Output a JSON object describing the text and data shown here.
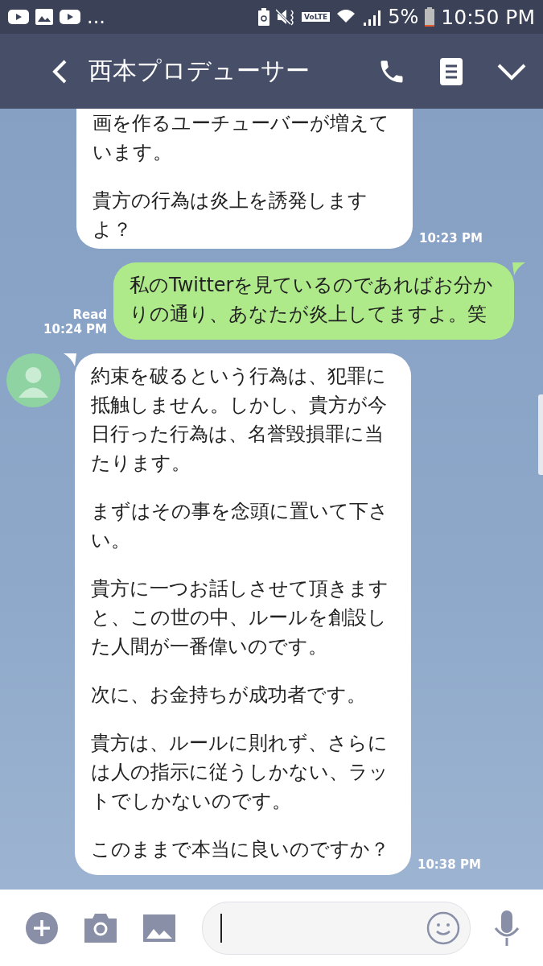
{
  "status_bar": {
    "more": "...",
    "volte": "VoLTE",
    "battery_percent": "5%",
    "time": "10:50 PM"
  },
  "header": {
    "title": "西本プロデューサー"
  },
  "messages": [
    {
      "kind": "received",
      "avatar": false,
      "paragraphs": [
        "画を作るユーチューバーが増えています。",
        "貴方の行為は炎上を誘発しますよ？"
      ],
      "time": "10:23 PM"
    },
    {
      "kind": "sent",
      "read": "Read",
      "paragraphs": [
        "私のTwitterを見ているのであればお分かりの通り、あなたが炎上してますよ。笑"
      ],
      "time": "10:24 PM"
    },
    {
      "kind": "received",
      "avatar": true,
      "paragraphs": [
        "約束を破るという行為は、犯罪に抵触しません。しかし、貴方が今日行った行為は、名誉毀損罪に当たります。",
        "まずはその事を念頭に置いて下さい。",
        "貴方に一つお話しさせて頂きますと、この世の中、ルールを創設した人間が一番偉いのです。",
        "次に、お金持ちが成功者です。",
        "貴方は、ルールに則れず、さらには人の指示に従うしかない、ラットでしかないのです。",
        "このままで本当に良いのですか？"
      ],
      "time": "10:38 PM"
    }
  ]
}
